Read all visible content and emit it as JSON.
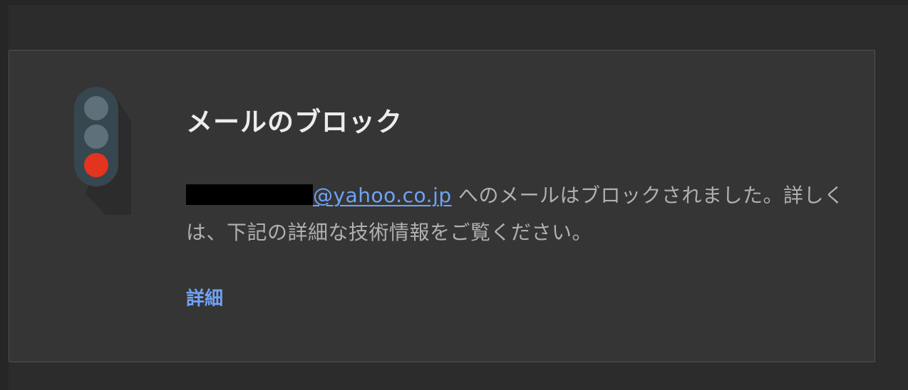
{
  "card": {
    "title": "メールのブロック",
    "message": {
      "email_visible_part": "@yahoo.co.jp",
      "text": " へのメールはブロックされました。詳しくは、下記の詳細な技術情報をご覧ください。"
    },
    "details_link": "詳細"
  },
  "icon": {
    "name": "traffic-light-icon",
    "colors": {
      "housing": "#37474f",
      "light_off": "#5e7079",
      "light_red": "#e3341f",
      "shadow": "#2a2a2a"
    }
  },
  "colors": {
    "page_background": "#2c2c2c",
    "card_background": "#353535",
    "card_border": "#505050",
    "title_text": "#ececec",
    "body_text": "#b0b0b0",
    "link": "#6fa3f6"
  }
}
